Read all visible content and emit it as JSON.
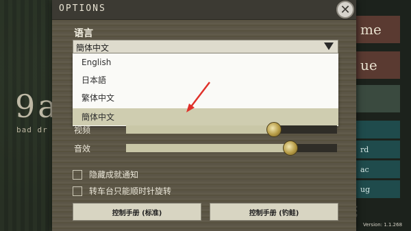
{
  "window": {
    "title": "OPTIONS"
  },
  "language": {
    "label": "语言",
    "selected": "簡体中文",
    "options": [
      {
        "label": "English"
      },
      {
        "label": "日本語"
      },
      {
        "label": "繁体中文"
      },
      {
        "label": "簡体中文",
        "selected": true
      }
    ]
  },
  "video": {
    "label": "视频",
    "level": 0.7
  },
  "audio": {
    "label": "音效",
    "level": 0.78
  },
  "checkboxes": [
    {
      "label": "隐藏成就通知",
      "checked": false
    },
    {
      "label": "转车台只能顺时针旋转",
      "checked": false
    }
  ],
  "buttons": {
    "manual_standard": "控制手册 (标准)",
    "manual_fishing": "控制手册 (钓鲑)"
  },
  "background": {
    "logo": "9a",
    "logo_sub": "bad dr",
    "menu_big": [
      "me",
      "ue"
    ],
    "menu_small": [
      "rd",
      "ac",
      "ug"
    ],
    "version": "Version: 1.1.268"
  },
  "colors": {
    "panel": "#5b5546",
    "highlight": "#cfcdb0",
    "arrow": "#e0312a"
  }
}
